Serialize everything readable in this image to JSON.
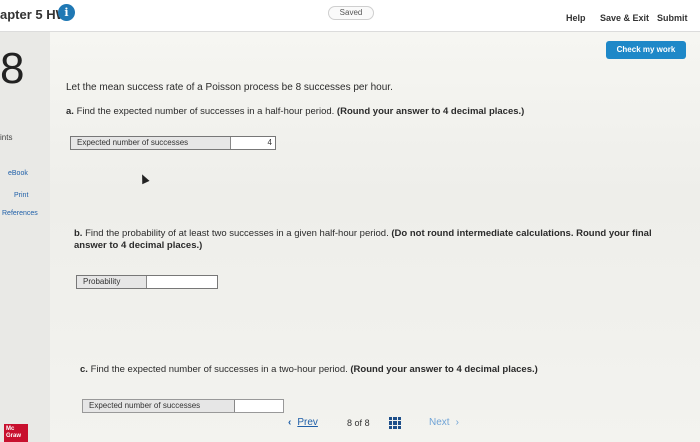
{
  "header": {
    "chapter_title": "apter 5 HW",
    "info_icon": "info-icon",
    "saved_badge": "Saved",
    "help": "Help",
    "save_exit": "Save & Exit",
    "submit": "Submit"
  },
  "question": {
    "number": "8",
    "points_label": "ints",
    "check_button": "Check my work",
    "prompt": "Let the mean success rate of a Poisson process be 8 successes per hour.",
    "part_a": {
      "letter": "a.",
      "text": "Find the expected number of successes in a half-hour period.",
      "note": "(Round your answer to 4 decimal places.)",
      "answer_label": "Expected number of successes",
      "answer_value": "4"
    },
    "part_b": {
      "letter": "b.",
      "text": "Find the probability of at least two successes in a given half-hour period.",
      "note": "(Do not round intermediate calculations. Round your final answer to 4 decimal places.)",
      "answer_label": "Probability",
      "answer_value": ""
    },
    "part_c": {
      "letter": "c.",
      "text": "Find the expected number of successes in a two-hour period.",
      "note": "(Round your answer to 4 decimal places.)",
      "answer_label": "Expected number of successes",
      "answer_value": ""
    }
  },
  "sidebar": {
    "ebook": "eBook",
    "print": "Print",
    "references": "References"
  },
  "pager": {
    "prev": "Prev",
    "page_current": "8",
    "page_of": "of",
    "page_total": "8",
    "next": "Next"
  },
  "logo": {
    "line1": "Mc",
    "line2": "Graw"
  },
  "colors": {
    "accent": "#1e88c8",
    "link": "#1f5fa8",
    "logo": "#c8102e"
  }
}
